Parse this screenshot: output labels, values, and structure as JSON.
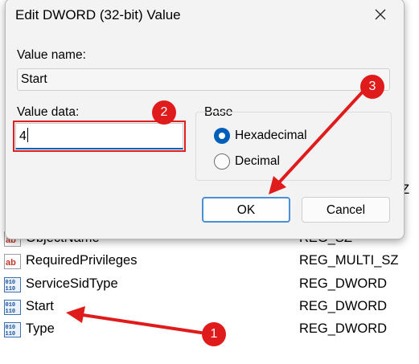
{
  "dialog": {
    "title": "Edit DWORD (32-bit) Value",
    "value_name_label": "Value name:",
    "value_name": "Start",
    "value_data_label": "Value data:",
    "value_data": "4",
    "base_label": "Base",
    "radio_hex": "Hexadecimal",
    "radio_dec": "Decimal",
    "selected_base": "Hexadecimal",
    "ok_label": "OK",
    "cancel_label": "Cancel"
  },
  "registry_list": {
    "partial_type_fragment": "SZ",
    "rows": [
      {
        "name": "ObjectName",
        "type": "REG_SZ",
        "icon": "string-value-icon"
      },
      {
        "name": "RequiredPrivileges",
        "type": "REG_MULTI_SZ",
        "icon": "string-value-icon"
      },
      {
        "name": "ServiceSidType",
        "type": "REG_DWORD",
        "icon": "binary-value-icon"
      },
      {
        "name": "Start",
        "type": "REG_DWORD",
        "icon": "binary-value-icon"
      },
      {
        "name": "Type",
        "type": "REG_DWORD",
        "icon": "binary-value-icon"
      }
    ]
  },
  "annotations": {
    "color": "#e01b1b",
    "step1": "1",
    "step2": "2",
    "step3": "3"
  },
  "colors": {
    "accent": "#005fb8",
    "dialog_bg": "#f3f3f3"
  }
}
